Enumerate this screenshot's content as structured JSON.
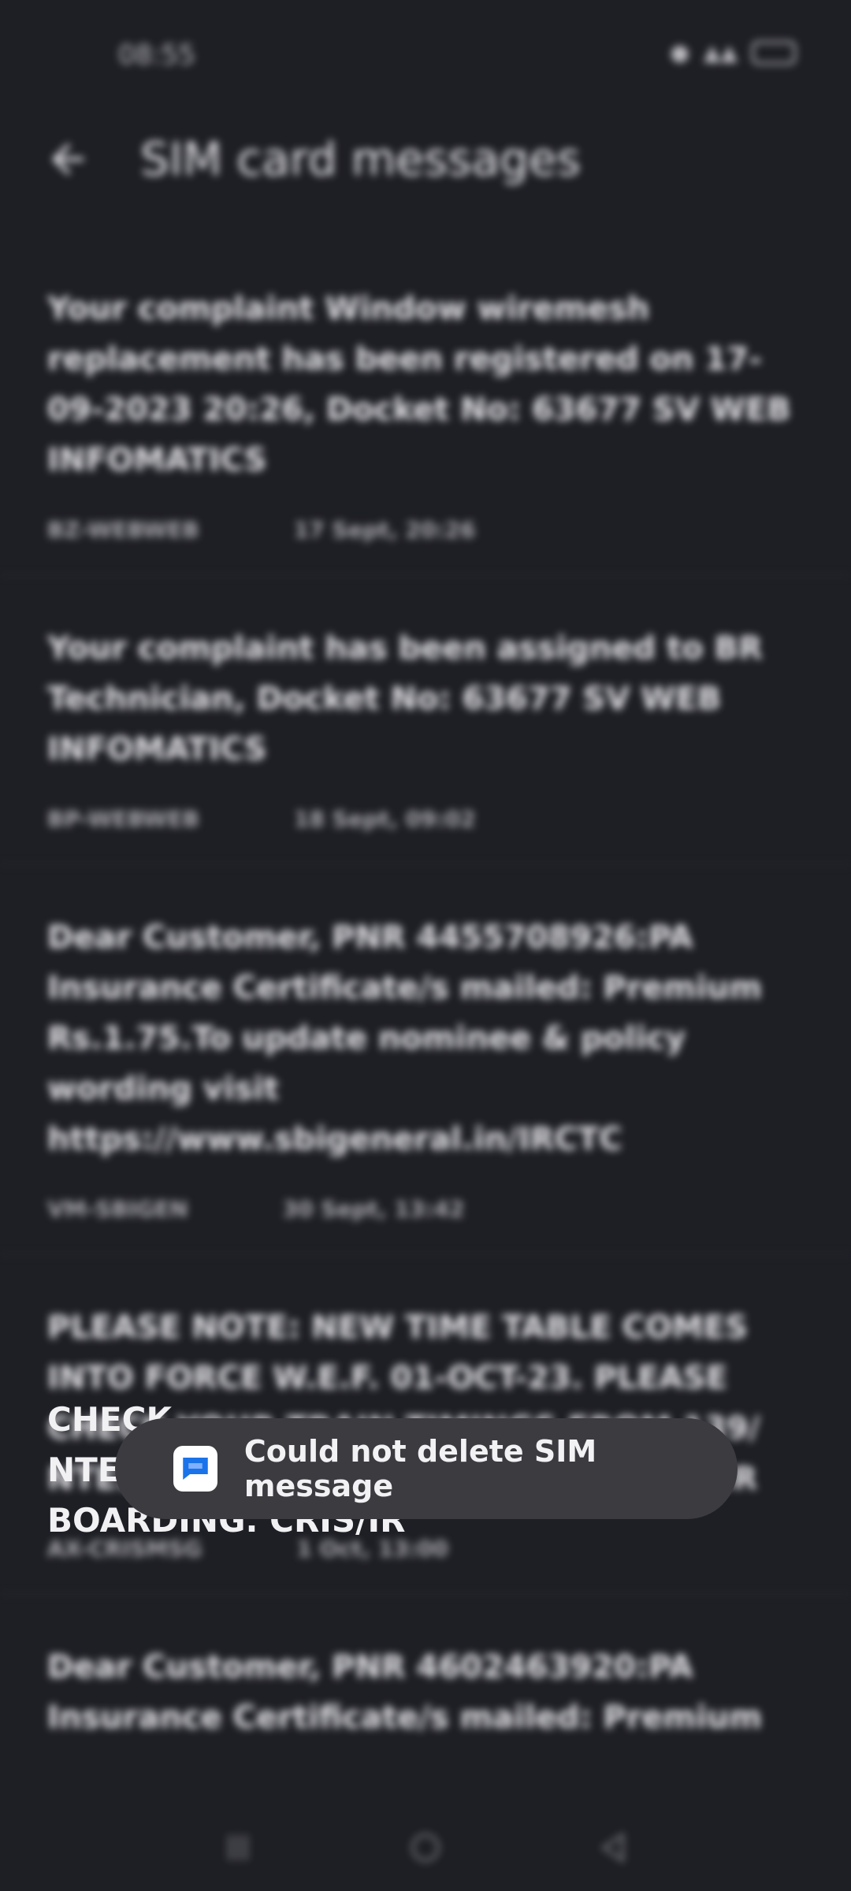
{
  "status_bar": {
    "time": "08:55"
  },
  "app_bar": {
    "title": "SIM card messages"
  },
  "messages": [
    {
      "body": "Your complaint Window wiremesh replacement has been registered on 17-09-2023 20:26, Docket No: 63677 SV WEB INFOMATICS",
      "sender": "BZ-WEBWEB",
      "time": "17 Sept, 20:26"
    },
    {
      "body": "Your complaint has been assigned to BR Technician, Docket No: 63677 SV WEB INFOMATICS",
      "sender": "BP-WEBWEB",
      "time": "18 Sept, 09:02"
    },
    {
      "body": "Dear Customer, PNR 4455708926:PA Insurance Certificate/s mailed: Premium Rs.1.75.To update nominee & policy wording visit https://www.sbigeneral.in/IRCTC",
      "sender": "VM-SBIGEN",
      "time": "30 Sept, 13:42"
    },
    {
      "body": "PLEASE NOTE: NEW TIME TABLE COMES INTO FORCE W.E.F. 01-OCT-23. PLEASE CHECK YOUR TRAIN TIMINGS FROM 139/ NTES/IRCTC BEFORE BOARDING. CRIS/IR",
      "sender": "AX-CRISMSG",
      "time": "1 Oct, 13:00"
    },
    {
      "body": "Dear Customer, PNR 4602463920:PA Insurance Certificate/s mailed: Premium",
      "sender": "",
      "time": ""
    }
  ],
  "visible_fragment": {
    "line1": "CHECK",
    "line2": "NTE",
    "line3": "BOARDING. CRIS/IR"
  },
  "toast": {
    "text": "Could not delete SIM message",
    "icon": "messages-app-icon"
  },
  "colors": {
    "background": "#1e1f25",
    "toast": "#3b3b40",
    "icon_blue": "#1a73e8"
  }
}
